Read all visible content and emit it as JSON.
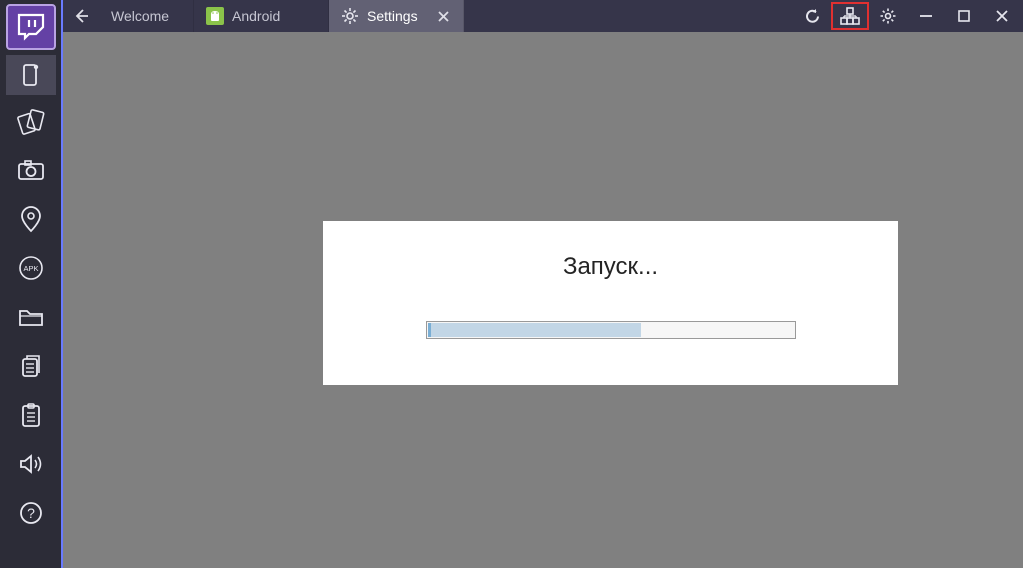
{
  "sidebar": {
    "items": [
      {
        "name": "twitch-logo",
        "label": "Twitch"
      },
      {
        "name": "emulator-icon",
        "label": "Emulator"
      },
      {
        "name": "rotate-icon",
        "label": "Rotate"
      },
      {
        "name": "camera-icon",
        "label": "Screenshot"
      },
      {
        "name": "location-icon",
        "label": "Location"
      },
      {
        "name": "apk-icon",
        "label": "APK"
      },
      {
        "name": "folder-icon",
        "label": "Folder"
      },
      {
        "name": "copy-icon",
        "label": "Copy"
      },
      {
        "name": "paste-icon",
        "label": "Paste"
      },
      {
        "name": "volume-icon",
        "label": "Volume"
      },
      {
        "name": "help-icon",
        "label": "Help"
      }
    ]
  },
  "tabs": [
    {
      "label": "Welcome",
      "active": false,
      "has_icon": false
    },
    {
      "label": "Android",
      "active": false,
      "has_icon": true
    },
    {
      "label": "Settings",
      "active": true,
      "has_icon": true,
      "closeable": true
    }
  ],
  "title_actions": {
    "reload": "Reload",
    "multi_instance": "Multi-instance",
    "settings": "Settings",
    "minimize": "Minimize",
    "maximize": "Maximize",
    "close": "Close"
  },
  "dialog": {
    "title": "Запуск...",
    "progress_percent": 58
  }
}
